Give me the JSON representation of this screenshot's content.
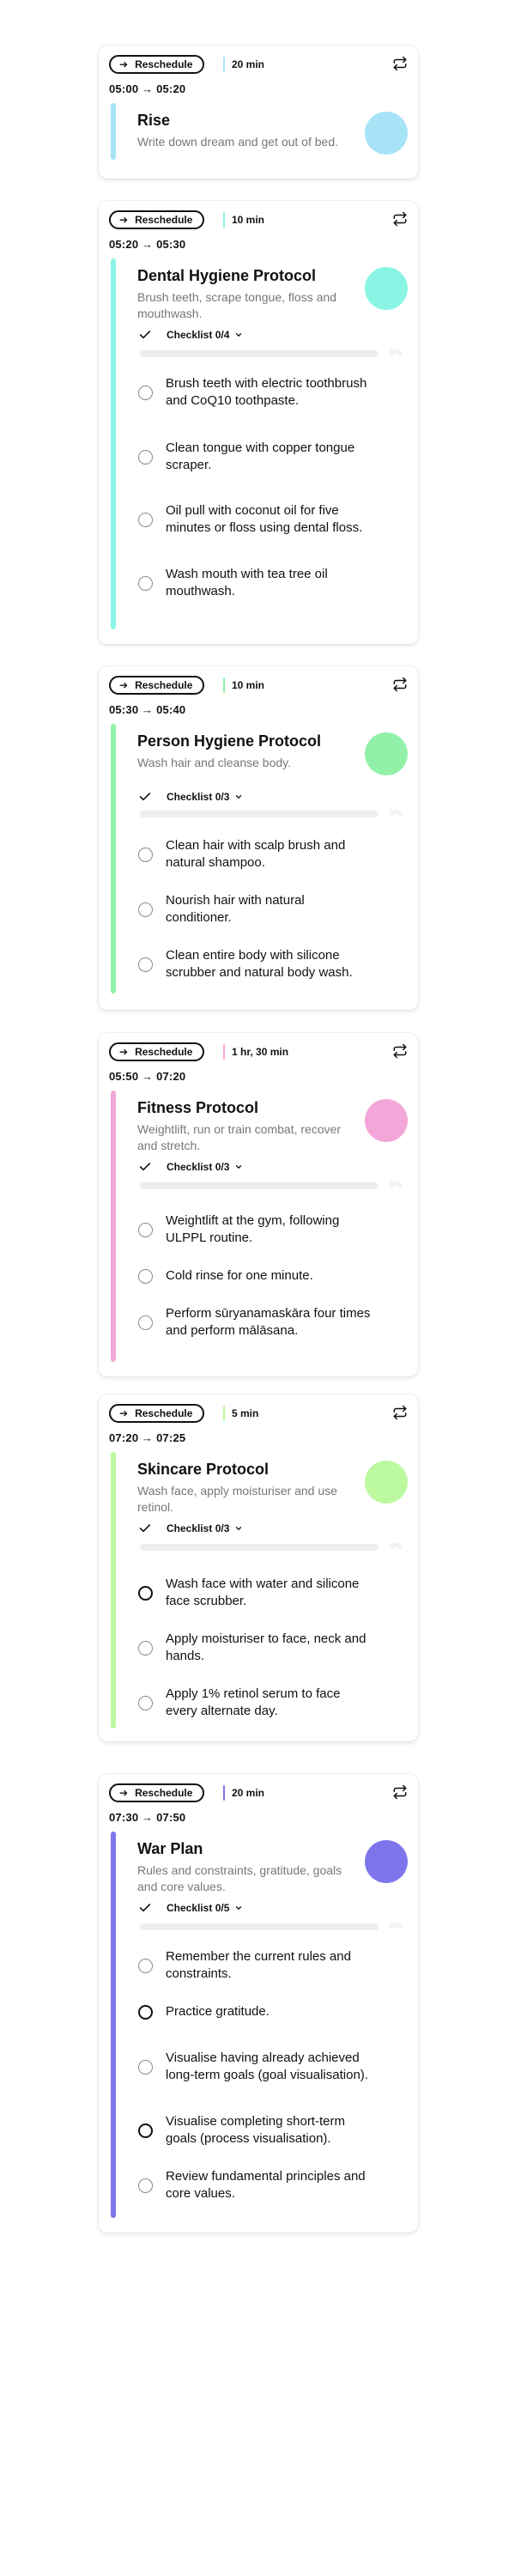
{
  "reschedule_label": "Reschedule",
  "checklist_label": "Checklist",
  "icons": {
    "reschedule": "arrow-right-icon",
    "repeat": "repeat-icon",
    "check": "check-icon",
    "chevron": "chevron-down-icon",
    "item": "radio-circle-icon"
  },
  "colors": {
    "text": "#111111",
    "secondary_text": "#777777",
    "progress_track": "#eeeeee"
  },
  "cards": [
    {
      "duration": "20 min",
      "time": "05:00 → 05:20",
      "title": "Rise",
      "description": "Write down dream and get out of bed.",
      "color": "#A7E3F7",
      "stripe_color": "#A7E3F7"
    },
    {
      "duration": "10 min",
      "time": "05:20 → 05:30",
      "title": "Dental Hygiene Protocol",
      "description": "Brush teeth, scrape tongue, floss and mouthwash.",
      "color": "#8AF5E5",
      "stripe_color": "#8AF5E5",
      "checklist_count": "0/4",
      "progress_label": "0%",
      "progress_fraction": 0,
      "items": [
        "Brush teeth with electric toothbrush and CoQ10 toothpaste.",
        "Clean tongue with copper tongue scraper.",
        "Oil pull with coconut oil for five minutes or floss using dental floss.",
        "Wash mouth with tea tree oil mouthwash."
      ]
    },
    {
      "duration": "10 min",
      "time": "05:30 → 05:40",
      "title": "Person Hygiene Protocol",
      "description": "Wash hair and cleanse body.",
      "color": "#92F1A8",
      "stripe_color": "#92F1A8",
      "checklist_count": "0/3",
      "progress_label": "0%",
      "progress_fraction": 0,
      "items": [
        "Clean hair with scalp brush and natural shampoo.",
        "Nourish hair with natural conditioner.",
        "Clean entire body with silicone scrubber and natural body wash."
      ]
    },
    {
      "duration": "1 hr, 30 min",
      "time": "05:50 → 07:20",
      "title": "Fitness Protocol",
      "description": "Weightlift, run or train combat, recover and stretch.",
      "color": "#F2A7D8",
      "stripe_color": "#F2A7D8",
      "checklist_count": "0/3",
      "progress_label": "0%",
      "progress_fraction": 0,
      "items": [
        "Weightlift at the gym, following ULPPL routine.",
        "Cold rinse for one minute.",
        "Perform sūryanamaskāra four times and perform mālāsana."
      ]
    },
    {
      "duration": "5 min",
      "time": "07:20 → 07:25",
      "title": "Skincare Protocol",
      "description": "Wash face, apply moisturiser and use retinol.",
      "color": "#BCF99F",
      "stripe_color": "#BCF99F",
      "checklist_count": "0/3",
      "progress_label": "0%",
      "progress_fraction": 0,
      "items": [
        "Wash face with water and silicone face scrubber.",
        "Apply moisturiser to face, neck and hands.",
        "Apply 1% retinol serum to face every alternate day."
      ]
    },
    {
      "duration": "20 min",
      "time": "07:30 → 07:50",
      "title": "War Plan",
      "description": "Rules and constraints, gratitude, goals and core values.",
      "color": "#7E75EC",
      "stripe_color": "#7E75EC",
      "checklist_count": "0/5",
      "progress_label": "0%",
      "progress_fraction": 0,
      "items": [
        "Remember the current rules and constraints.",
        "Practice gratitude.",
        "Visualise having already achieved long-term goals (goal visualisation).",
        "Visualise completing short-term goals (process visualisation).",
        "Review fundamental principles and core values."
      ]
    }
  ]
}
